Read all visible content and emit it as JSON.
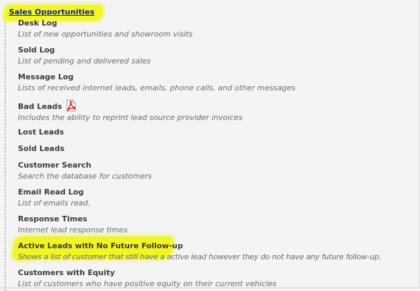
{
  "section": {
    "title": "Sales Opportunities"
  },
  "items": [
    {
      "title": "Desk Log",
      "desc": "List of new opportunities and showroom visits"
    },
    {
      "title": "Sold Log",
      "desc": "List of pending and delivered sales"
    },
    {
      "title": "Message Log",
      "desc": "Lists of received internet leads, emails, phone calls, and other messages"
    },
    {
      "title": "Bad Leads",
      "desc": "Includes the ability to reprint lead source provider invoices",
      "icon": "pdf-icon"
    },
    {
      "title": "Lost Leads",
      "desc": ""
    },
    {
      "title": "Sold Leads",
      "desc": ""
    },
    {
      "title": "Customer Search",
      "desc": "Search the database for customers"
    },
    {
      "title": "Email Read Log",
      "desc": "List of emails read."
    },
    {
      "title": "Response Times",
      "desc": "Internet lead response times"
    },
    {
      "title": "Active Leads with No Future Follow-up",
      "desc": "Shows a list of customer that still have a active lead however they do not have any future follow-up."
    },
    {
      "title": "Customers with Equity",
      "desc": "List of customers who have positive equity on their current vehicles"
    }
  ],
  "highlight_color": "#f0f526",
  "link_color": "#0a1f9a"
}
